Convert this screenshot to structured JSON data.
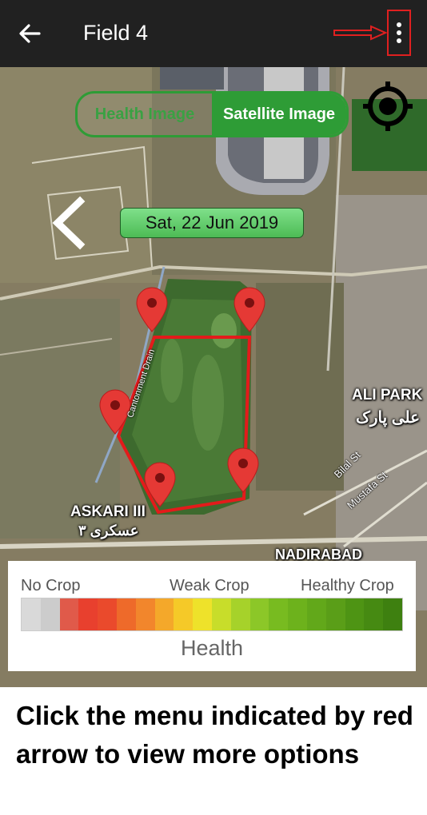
{
  "header": {
    "title": "Field 4",
    "back_icon": "arrow-left-icon",
    "menu_icon": "more-vertical-icon",
    "annotation_color": "#e02020"
  },
  "map": {
    "toggle": {
      "health_label": "Health Image",
      "satellite_label": "Satellite Image",
      "selected": "Satellite Image"
    },
    "locate_icon": "crosshair-icon",
    "prev_icon": "chevron-left-icon",
    "date": "Sat, 22 Jun 2019",
    "field_outline_color": "#e31b1b",
    "places": {
      "ali_park": "ALI PARK",
      "ali_park_urdu": "علی پارک",
      "askari": "ASKARI III",
      "askari_urdu": "عسکری ۳",
      "nadirabad": "NADIRABAD"
    },
    "streets": {
      "bilal": "Bilal St",
      "mustafa": "Mustafa St",
      "drain": "Cantonment Drain"
    }
  },
  "legend": {
    "no_crop": "No Crop",
    "weak_crop": "Weak Crop",
    "healthy_crop": "Healthy Crop",
    "caption": "Health",
    "colors": [
      "#d9d9d9",
      "#cccccc",
      "#e05a4a",
      "#e8402e",
      "#ea4a2c",
      "#ee6a2a",
      "#f2862c",
      "#f4a82a",
      "#f5c928",
      "#eee22a",
      "#c8dd2a",
      "#a6d22a",
      "#8cc728",
      "#78bb20",
      "#6db21c",
      "#62a81a",
      "#5a9e18",
      "#4e9414",
      "#468a12",
      "#3e8010"
    ]
  },
  "instruction": "Click the menu indicated by red arrow to view more options"
}
